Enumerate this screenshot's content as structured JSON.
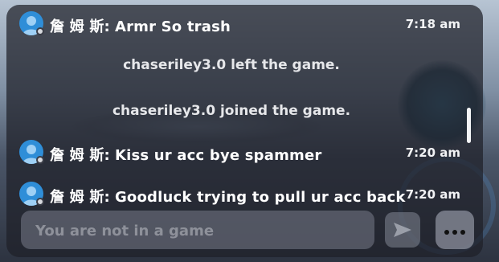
{
  "chat": {
    "messages": [
      {
        "type": "user",
        "name": "詹 姆 斯:",
        "text": "Armr So trash",
        "time": "7:18 am"
      },
      {
        "type": "system",
        "text": "chaseriley3.0 left the game."
      },
      {
        "type": "system",
        "text": "chaseriley3.0 joined the game."
      },
      {
        "type": "user",
        "name": "詹 姆 斯:",
        "text": "Kiss ur acc bye spammer",
        "time": "7:20 am"
      },
      {
        "type": "user",
        "name": "詹 姆 斯:",
        "text": "Goodluck trying to pull ur acc back",
        "time": "7:20 am"
      }
    ]
  },
  "composer": {
    "placeholder": "You are not in a game",
    "send_icon": "send-arrow-icon",
    "more_icon": "more-dots-icon"
  },
  "colors": {
    "avatar_bg": "#2f8ed8",
    "panel_bg": "rgba(30,32,40,0.72)"
  }
}
